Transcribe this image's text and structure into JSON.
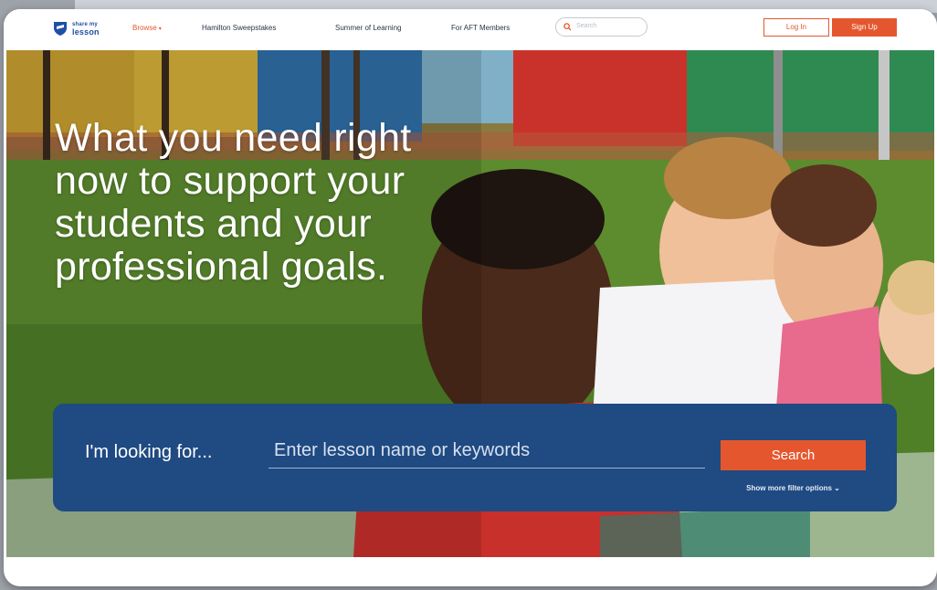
{
  "nav": {
    "logo_line1": "share my",
    "logo_line2": "lesson",
    "browse": "Browse",
    "links": [
      "Hamilton Sweepstakes",
      "Summer of Learning",
      "For AFT Members"
    ],
    "search_placeholder": "Search",
    "login": "Log In",
    "signup": "Sign Up"
  },
  "hero": {
    "title": "What you need right now to support your students and your professional goals."
  },
  "search_panel": {
    "label": "I'm looking for...",
    "placeholder": "Enter lesson name or keywords",
    "button": "Search",
    "more_filters": "Show more filter options"
  },
  "colors": {
    "accent": "#e4572e",
    "panel": "#1f4a82",
    "brand_blue": "#1f4fa6"
  }
}
